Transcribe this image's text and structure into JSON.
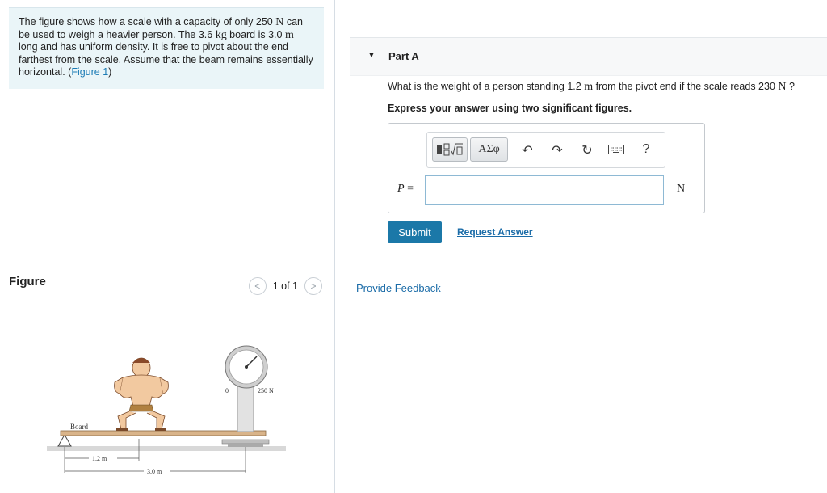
{
  "problem": {
    "text_1": "The figure shows how a scale with a capacity of only 250 ",
    "unit_N": "N",
    "text_2": " can be used to weigh a heavier person. The 3.6 ",
    "unit_kg": "kg",
    "text_3": " board is 3.0 ",
    "unit_m": "m",
    "text_4": " long and has uniform density. It is free to pivot about the end farthest from the scale. Assume that the beam remains essentially horizontal. (",
    "figure_link": "Figure 1",
    "text_5": ")"
  },
  "figure_panel": {
    "title": "Figure",
    "pager_text": "1 of 1",
    "prev_icon": "chevron-left",
    "next_icon": "chevron-right"
  },
  "figure": {
    "scale_zero": "0",
    "scale_max": "250 N",
    "board_label": "Board",
    "dim_person": "1.2 m",
    "dim_board": "3.0 m"
  },
  "part_a": {
    "caret_icon": "triangle-down",
    "title": "Part A",
    "question_1": "What is the weight of a person standing 1.2 ",
    "question_unit_m": "m",
    "question_2": " from the pivot end if the scale reads 230 ",
    "question_unit_N": "N",
    "question_3": " ?",
    "instruction": "Express your answer using two significant figures.",
    "toolbar": {
      "template_icon": "fraction-root-template",
      "greek_label": "ΑΣφ",
      "undo_icon": "undo-arrow",
      "redo_icon": "redo-arrow",
      "reset_icon": "reset-circle-arrow",
      "keyboard_icon": "keyboard",
      "help_label": "?"
    },
    "answer_label": "P",
    "answer_equals": "=",
    "answer_value": "",
    "unit": "N",
    "submit_label": "Submit",
    "request_label": "Request Answer"
  },
  "feedback_label": "Provide Feedback",
  "colors": {
    "link": "#1b6ca8",
    "submit_bg": "#1b78a8",
    "problem_bg": "#eaf5f8"
  }
}
